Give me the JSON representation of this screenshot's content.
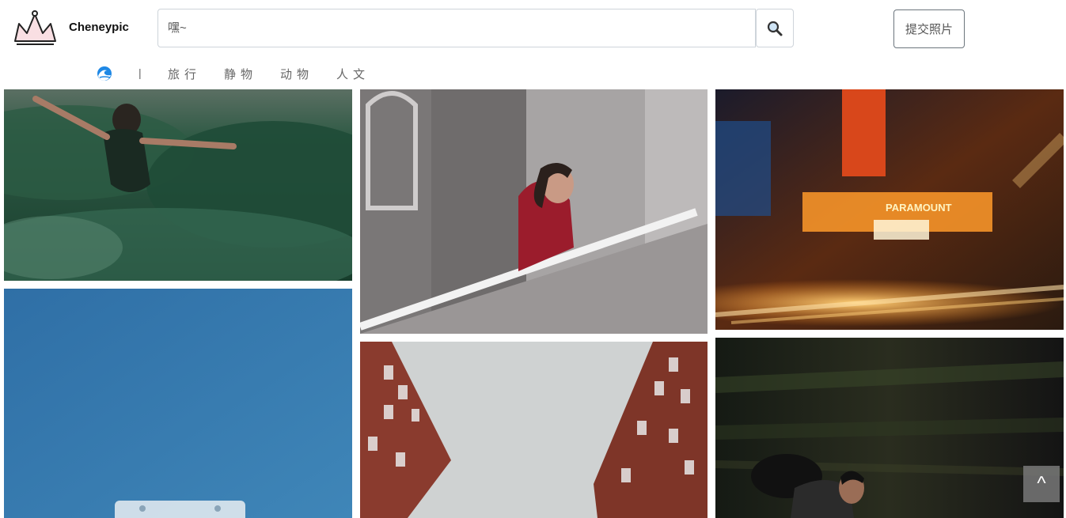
{
  "header": {
    "brand": "Cheneypic",
    "search_placeholder": "嘿~",
    "submit_label": "提交照片",
    "colors": {
      "logo_fill": "#f9dfe3",
      "logo_stroke": "#222222"
    }
  },
  "nav": {
    "separator": "|",
    "home_icon": "wave-icon",
    "categories": [
      "旅行",
      "静物",
      "动物",
      "人文"
    ]
  },
  "gallery": {
    "photos": [
      "woman-arms-outstretched-forest",
      "woman-red-dress-balcony",
      "neon-theater-street-night",
      "cassette-tape-blue-sky",
      "brick-buildings-looking-up",
      "cyclist-motion-blur-night"
    ],
    "neon_sign": "PARAMOUNT"
  },
  "back_to_top": {
    "label": "^"
  }
}
